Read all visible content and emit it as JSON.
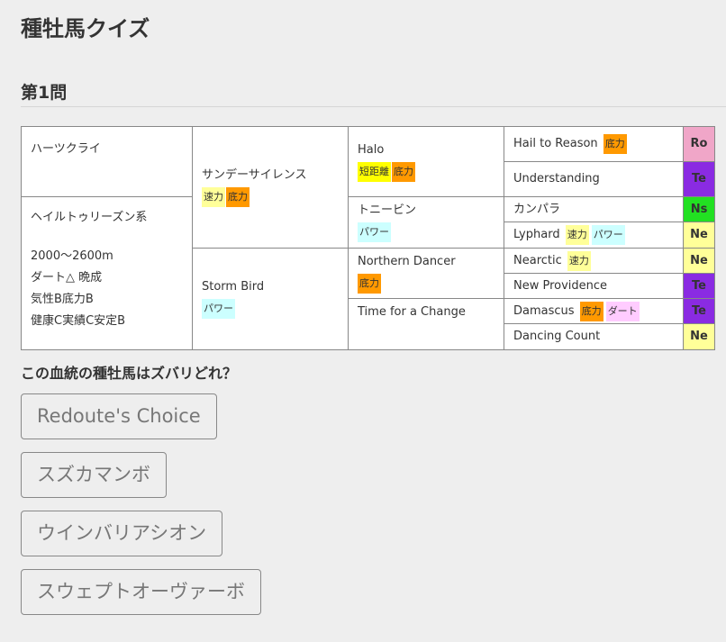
{
  "site": {
    "title": "種牡馬クイズ"
  },
  "quiz": {
    "heading": "第1問",
    "question": "この血統の種牡馬はズバリどれ？"
  },
  "tags": {
    "speed": "速力",
    "stamina": "底力",
    "power": "パワー",
    "short": "短距離",
    "dirt": "ダート"
  },
  "pedigree": {
    "col1": {
      "top": "ハーツクライ",
      "bottom_title": "ヘイルトゥリーズン系",
      "lines": [
        "2000～2600m",
        "ダート△ 晩成",
        "気性B底力B",
        "健康C実績C安定B"
      ]
    },
    "sire": {
      "name": "サンデーサイレンス"
    },
    "dam_sire": {
      "name": "Storm Bird"
    },
    "gen3": [
      "Halo",
      "トニービン",
      "Northern Dancer",
      "Time for a Change"
    ],
    "gen4": [
      {
        "name": "Hail to Reason",
        "type": "Ro"
      },
      {
        "name": "Understanding",
        "type": "Te"
      },
      {
        "name": "カンパラ",
        "type": "Ns"
      },
      {
        "name": "Lyphard",
        "type": "Ne"
      },
      {
        "name": "Nearctic",
        "type": "Ne"
      },
      {
        "name": "New Providence",
        "type": "Te"
      },
      {
        "name": "Damascus",
        "type": "Te"
      },
      {
        "name": "Dancing Count",
        "type": "Ne"
      }
    ]
  },
  "choices": [
    "Redoute's Choice",
    "スズカマンボ",
    "ウインバリアシオン",
    "スウェプトオーヴァーボ"
  ],
  "colors": {
    "type_ro": "#f0a6c8",
    "type_te": "#8a2be2",
    "type_ns": "#22e022",
    "type_ne": "#ffff99",
    "tag_speed": "#ffff99",
    "tag_stamina": "#ff9900",
    "tag_power": "#ccffff",
    "tag_short": "#ffff00",
    "tag_dirt": "#ffccff"
  }
}
